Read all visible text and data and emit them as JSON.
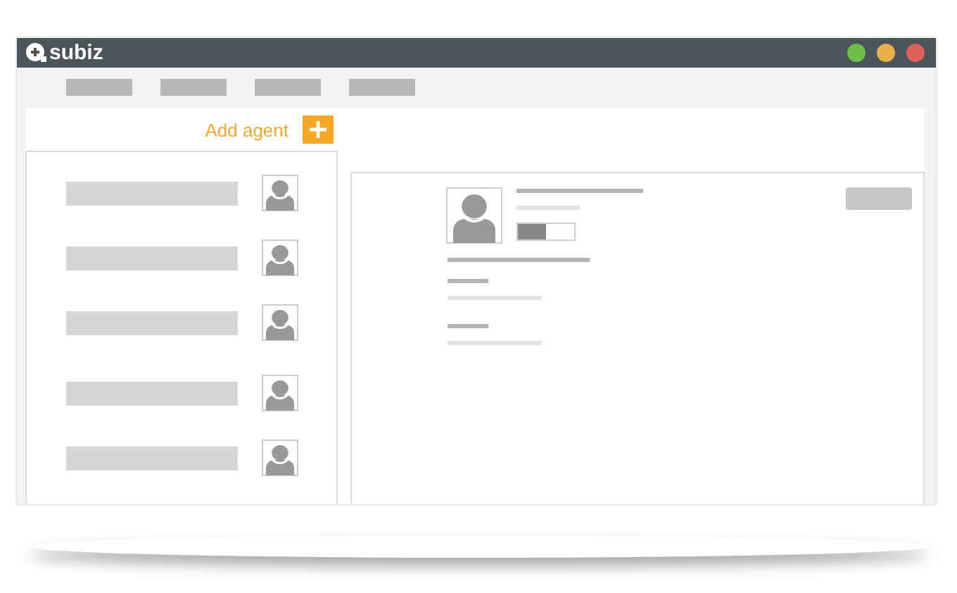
{
  "window": {
    "logo": "subiz",
    "controls": [
      {
        "color": "#6cc04a"
      },
      {
        "color": "#e8b04a"
      },
      {
        "color": "#e0605a"
      }
    ]
  },
  "nav": [
    {
      "kind": "placeholder"
    },
    {
      "kind": "placeholder"
    },
    {
      "kind": "placeholder"
    },
    {
      "kind": "placeholder"
    }
  ],
  "agents_panel": {
    "add_label": "Add agent",
    "agents": [
      {
        "kind": "placeholder"
      },
      {
        "kind": "placeholder"
      },
      {
        "kind": "placeholder"
      },
      {
        "kind": "placeholder"
      },
      {
        "kind": "placeholder"
      }
    ]
  },
  "detail": {
    "status_toggle": {
      "on": true
    }
  }
}
